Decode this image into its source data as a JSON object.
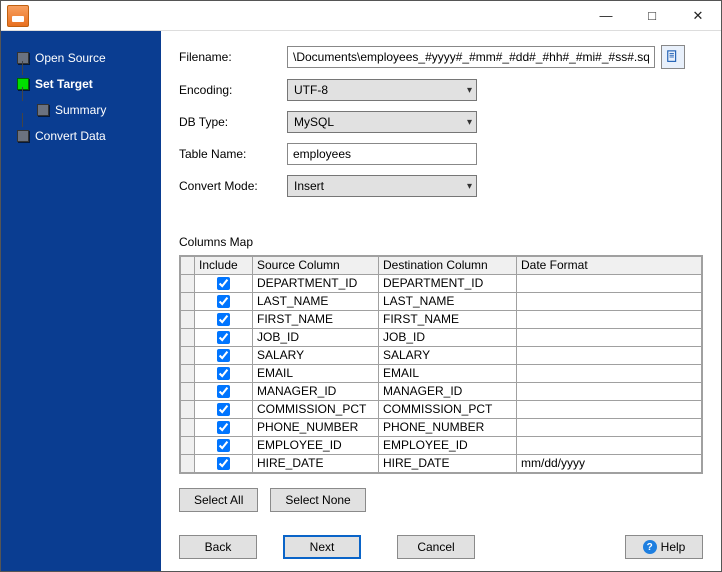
{
  "window": {
    "title": ""
  },
  "steps": [
    {
      "label": "Open Source",
      "active": false,
      "sub": false
    },
    {
      "label": "Set Target",
      "active": true,
      "sub": false
    },
    {
      "label": "Summary",
      "active": false,
      "sub": true
    },
    {
      "label": "Convert Data",
      "active": false,
      "sub": false
    }
  ],
  "form": {
    "filename_label": "Filename:",
    "filename_value": "\\Documents\\employees_#yyyy#_#mm#_#dd#_#hh#_#mi#_#ss#.sql",
    "encoding_label": "Encoding:",
    "encoding_value": "UTF-8",
    "dbtype_label": "DB Type:",
    "dbtype_value": "MySQL",
    "tablename_label": "Table Name:",
    "tablename_value": "employees",
    "convertmode_label": "Convert Mode:",
    "convertmode_value": "Insert"
  },
  "columns_map": {
    "title": "Columns Map",
    "headers": {
      "include": "Include",
      "source": "Source Column",
      "dest": "Destination Column",
      "datefmt": "Date Format"
    },
    "rows": [
      {
        "include": true,
        "source": "DEPARTMENT_ID",
        "dest": "DEPARTMENT_ID",
        "datefmt": ""
      },
      {
        "include": true,
        "source": "LAST_NAME",
        "dest": "LAST_NAME",
        "datefmt": ""
      },
      {
        "include": true,
        "source": "FIRST_NAME",
        "dest": "FIRST_NAME",
        "datefmt": ""
      },
      {
        "include": true,
        "source": "JOB_ID",
        "dest": "JOB_ID",
        "datefmt": ""
      },
      {
        "include": true,
        "source": "SALARY",
        "dest": "SALARY",
        "datefmt": ""
      },
      {
        "include": true,
        "source": "EMAIL",
        "dest": "EMAIL",
        "datefmt": ""
      },
      {
        "include": true,
        "source": "MANAGER_ID",
        "dest": "MANAGER_ID",
        "datefmt": ""
      },
      {
        "include": true,
        "source": "COMMISSION_PCT",
        "dest": "COMMISSION_PCT",
        "datefmt": ""
      },
      {
        "include": true,
        "source": "PHONE_NUMBER",
        "dest": "PHONE_NUMBER",
        "datefmt": ""
      },
      {
        "include": true,
        "source": "EMPLOYEE_ID",
        "dest": "EMPLOYEE_ID",
        "datefmt": ""
      },
      {
        "include": true,
        "source": "HIRE_DATE",
        "dest": "HIRE_DATE",
        "datefmt": "mm/dd/yyyy"
      }
    ]
  },
  "buttons": {
    "select_all": "Select All",
    "select_none": "Select None",
    "back": "Back",
    "next": "Next",
    "cancel": "Cancel",
    "help": "Help"
  }
}
